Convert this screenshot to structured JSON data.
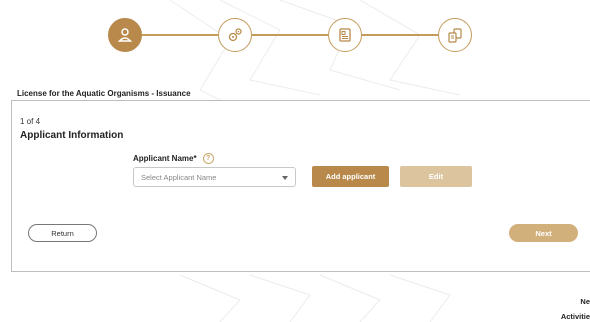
{
  "stepper": {
    "steps": [
      {
        "icon": "user-icon",
        "state": "active"
      },
      {
        "icon": "gears-icon",
        "state": "inactive"
      },
      {
        "icon": "document-icon",
        "state": "inactive"
      },
      {
        "icon": "files-edit-icon",
        "state": "inactive"
      }
    ]
  },
  "page": {
    "title": "License for the Aquatic Organisms - Issuance"
  },
  "form": {
    "step_count": "1 of 4",
    "section_title": "Applicant Information",
    "applicant_label": "Applicant Name*",
    "help_icon": "?",
    "select_placeholder": "Select Applicant Name",
    "add_applicant_label": "Add applicant",
    "edit_label": "Edit",
    "return_label": "Return",
    "next_label": "Next"
  },
  "corner": {
    "line1": "Ne",
    "line2": "Activitie"
  },
  "colors": {
    "accent": "#b8894a",
    "accent_light": "#dcc49f",
    "next_bg": "#d2b07c"
  }
}
